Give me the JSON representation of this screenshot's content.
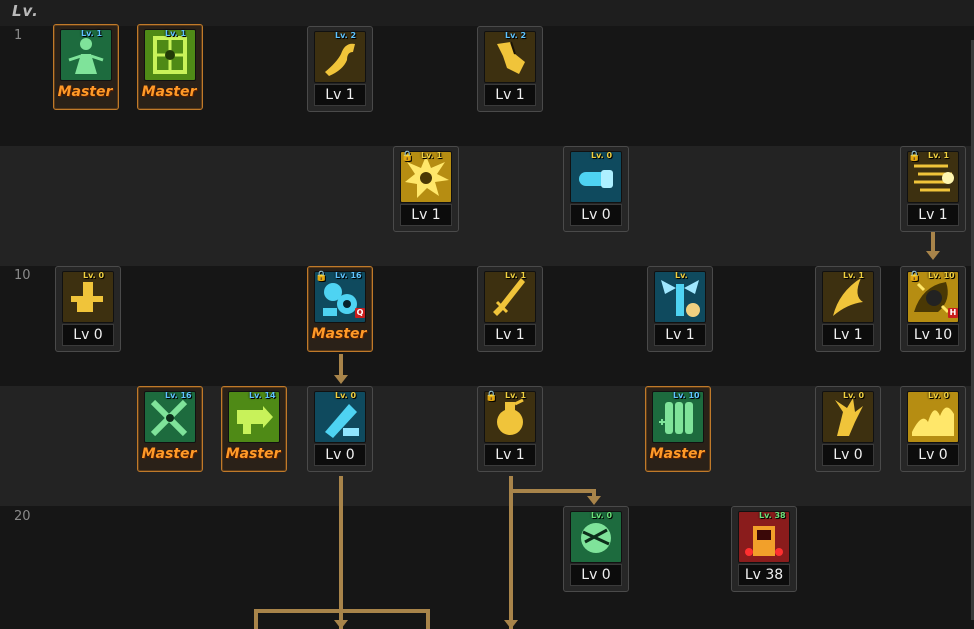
{
  "header": {
    "level_heading": "Lv."
  },
  "row_labels": [
    "1",
    "10",
    "20"
  ],
  "skills": [
    {
      "id": "s1",
      "level": "",
      "master": "Master",
      "tag": "Lv. 1",
      "tag_color": "blue",
      "lock": false,
      "hotkey": "",
      "palette": "green",
      "glyph": "figure-icon"
    },
    {
      "id": "s2",
      "level": "",
      "master": "Master",
      "tag": "Lv. 1",
      "tag_color": "blue",
      "lock": false,
      "hotkey": "",
      "palette": "lime",
      "glyph": "crosshair-figure-icon"
    },
    {
      "id": "s3",
      "level": "Lv 1",
      "master": "",
      "tag": "Lv. 2",
      "tag_color": "blue",
      "lock": false,
      "hotkey": "",
      "palette": "gold",
      "glyph": "flex-arm-icon"
    },
    {
      "id": "s4",
      "level": "Lv 1",
      "master": "",
      "tag": "Lv. 2",
      "tag_color": "blue",
      "lock": false,
      "hotkey": "",
      "palette": "gold",
      "glyph": "muscle-arm-icon"
    },
    {
      "id": "s5",
      "level": "Lv 1",
      "master": "",
      "tag": "Lv. 1",
      "tag_color": "yellow",
      "lock": true,
      "hotkey": "",
      "palette": "yellow",
      "glyph": "explosion-icon"
    },
    {
      "id": "s6",
      "level": "Lv 0",
      "master": "",
      "tag": "Lv. 0",
      "tag_color": "yellow",
      "lock": false,
      "hotkey": "",
      "palette": "cyan",
      "glyph": "capsule-icon"
    },
    {
      "id": "s7",
      "level": "Lv 1",
      "master": "",
      "tag": "Lv. 1",
      "tag_color": "yellow",
      "lock": true,
      "hotkey": "",
      "palette": "gold",
      "glyph": "dash-icon"
    },
    {
      "id": "s8",
      "level": "Lv 0",
      "master": "",
      "tag": "Lv. 0",
      "tag_color": "yellow",
      "lock": false,
      "hotkey": "",
      "palette": "gold",
      "glyph": "anvil-icon"
    },
    {
      "id": "s9",
      "level": "",
      "master": "Master",
      "tag": "Lv. 16",
      "tag_color": "blue",
      "lock": true,
      "hotkey": "Q",
      "palette": "cyan",
      "glyph": "machinery-icon"
    },
    {
      "id": "s10",
      "level": "Lv 1",
      "master": "",
      "tag": "Lv. 1",
      "tag_color": "yellow",
      "lock": false,
      "hotkey": "",
      "palette": "gold",
      "glyph": "blade-icon"
    },
    {
      "id": "s11",
      "level": "Lv 1",
      "master": "",
      "tag": "Lv.",
      "tag_color": "yellow",
      "lock": false,
      "hotkey": "",
      "palette": "cyan",
      "glyph": "winged-pillar-icon"
    },
    {
      "id": "s12",
      "level": "Lv 1",
      "master": "",
      "tag": "Lv. 1",
      "tag_color": "yellow",
      "lock": false,
      "hotkey": "",
      "palette": "gold",
      "glyph": "wing-slash-icon"
    },
    {
      "id": "s13",
      "level": "Lv 10",
      "master": "",
      "tag": "Lv. 10",
      "tag_color": "yellow",
      "lock": true,
      "hotkey": "H",
      "palette": "yellow",
      "glyph": "dark-burst-icon"
    },
    {
      "id": "s14",
      "level": "",
      "master": "Master",
      "tag": "Lv. 16",
      "tag_color": "blue",
      "lock": false,
      "hotkey": "",
      "palette": "green",
      "glyph": "crossed-weapons-icon"
    },
    {
      "id": "s15",
      "level": "",
      "master": "Master",
      "tag": "Lv. 14",
      "tag_color": "blue",
      "lock": false,
      "hotkey": "",
      "palette": "lime",
      "glyph": "cannon-icon"
    },
    {
      "id": "s16",
      "level": "Lv 0",
      "master": "",
      "tag": "Lv. 0",
      "tag_color": "yellow",
      "lock": false,
      "hotkey": "",
      "palette": "cyan",
      "glyph": "launcher-icon"
    },
    {
      "id": "s17",
      "level": "Lv 1",
      "master": "",
      "tag": "Lv. 1",
      "tag_color": "yellow",
      "lock": true,
      "hotkey": "",
      "palette": "gold",
      "glyph": "grenade-icon"
    },
    {
      "id": "s18",
      "level": "",
      "master": "Master",
      "tag": "Lv. 10",
      "tag_color": "blue",
      "lock": false,
      "hotkey": "",
      "palette": "green",
      "glyph": "ammo-icon"
    },
    {
      "id": "s19",
      "level": "Lv 0",
      "master": "",
      "tag": "Lv. 0",
      "tag_color": "yellow",
      "lock": false,
      "hotkey": "",
      "palette": "gold",
      "glyph": "claw-icon"
    },
    {
      "id": "s20",
      "level": "Lv 0",
      "master": "",
      "tag": "Lv. 0",
      "tag_color": "yellow",
      "lock": false,
      "hotkey": "",
      "palette": "yellow",
      "glyph": "flame-wave-icon"
    },
    {
      "id": "s21",
      "level": "Lv 0",
      "master": "",
      "tag": "Lv. 0",
      "tag_color": "green",
      "lock": false,
      "hotkey": "",
      "palette": "green",
      "glyph": "mine-icon"
    },
    {
      "id": "s22",
      "level": "Lv 38",
      "master": "",
      "tag": "Lv. 38",
      "tag_color": "green",
      "lock": false,
      "hotkey": "",
      "palette": "red",
      "glyph": "guardian-icon"
    }
  ],
  "palettes": {
    "green": {
      "bg": "#1d6b3e",
      "fg": "#7fe39a",
      "dark": "#0c2e1a"
    },
    "lime": {
      "bg": "#4f8a16",
      "fg": "#c8f25a",
      "dark": "#213a08"
    },
    "gold": {
      "bg": "#3d3010",
      "fg": "#f0c43a",
      "dark": "#1a1406"
    },
    "yellow": {
      "bg": "#b68d12",
      "fg": "#ffe76a",
      "dark": "#4a3804"
    },
    "cyan": {
      "bg": "#0f4a5e",
      "fg": "#4ed3f2",
      "dark": "#06222c"
    },
    "red": {
      "bg": "#8a1c1c",
      "fg": "#f2a02a",
      "dark": "#3a0808"
    }
  },
  "colors": {
    "master_text": "#ff9a28",
    "connector": "#a8844a",
    "hotkey_bg": "#c81e1e"
  }
}
